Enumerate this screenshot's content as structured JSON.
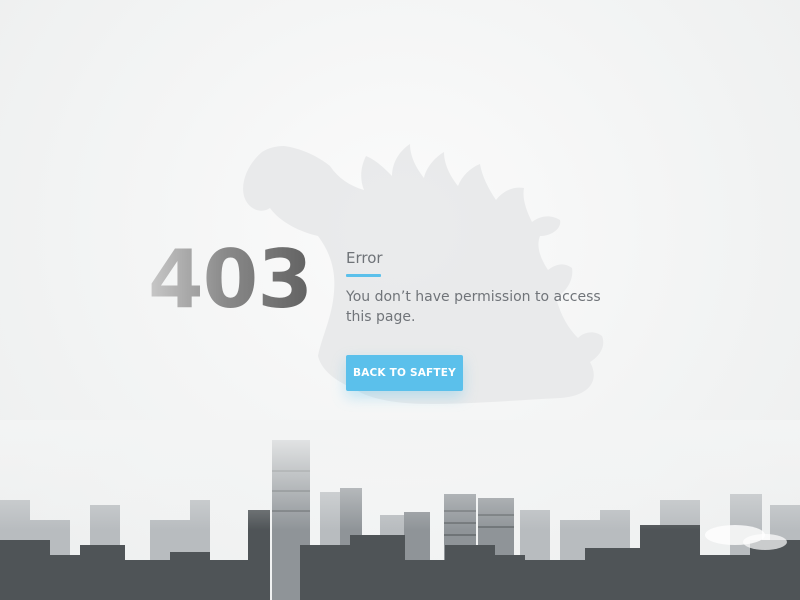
{
  "error": {
    "code": "403",
    "title": "Error",
    "message": "You don’t have permission to access this page."
  },
  "actions": {
    "back_label": "BACK TO SAFTEY"
  },
  "colors": {
    "accent": "#5bc0eb",
    "text": "#707479",
    "background": "#f3f4f4"
  },
  "background": {
    "illustration": "godzilla-silhouette",
    "scene": "foggy-city-skyline"
  }
}
